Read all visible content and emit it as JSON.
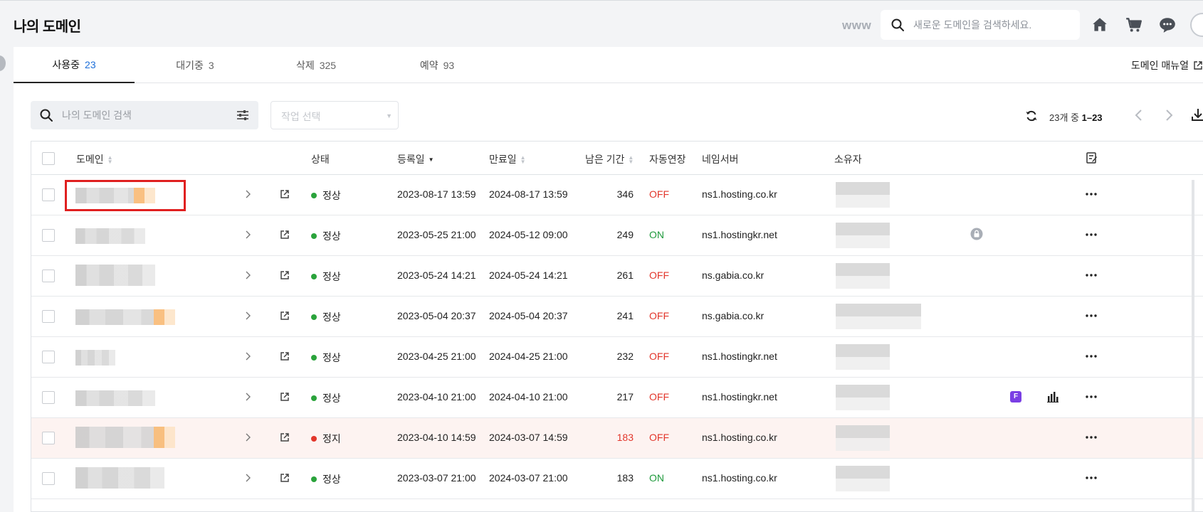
{
  "header": {
    "title": "나의 도메인",
    "www": "www",
    "search_placeholder": "새로운 도메인을 검색하세요."
  },
  "tabs": [
    {
      "label": "사용중",
      "count": "23",
      "active": true
    },
    {
      "label": "대기중",
      "count": "3"
    },
    {
      "label": "삭제",
      "count": "325"
    },
    {
      "label": "예약",
      "count": "93"
    }
  ],
  "manual_link": "도메인 매뉴얼",
  "toolbar": {
    "search_placeholder": "나의 도메인 검색",
    "action_select": "작업 선택",
    "range_prefix": "23개 중 ",
    "range_value": "1–23"
  },
  "table": {
    "columns": {
      "domain": "도메인",
      "status": "상태",
      "registered": "등록일",
      "expires": "만료일",
      "remaining": "남은 기간",
      "auto_renew": "자동연장",
      "nameserver": "네임서버",
      "owner": "소유자"
    },
    "rows": [
      {
        "status": "정상",
        "registered": "2023-08-17 13:59",
        "expires": "2024-08-17 13:59",
        "remaining": "346",
        "auto_renew": "OFF",
        "nameserver": "ns1.hosting.co.kr"
      },
      {
        "status": "정상",
        "registered": "2023-05-25 21:00",
        "expires": "2024-05-12 09:00",
        "remaining": "249",
        "auto_renew": "ON",
        "nameserver": "ns1.hostingkr.net"
      },
      {
        "status": "정상",
        "registered": "2023-05-24 14:21",
        "expires": "2024-05-24 14:21",
        "remaining": "261",
        "auto_renew": "OFF",
        "nameserver": "ns.gabia.co.kr"
      },
      {
        "status": "정상",
        "registered": "2023-05-04 20:37",
        "expires": "2024-05-04 20:37",
        "remaining": "241",
        "auto_renew": "OFF",
        "nameserver": "ns.gabia.co.kr"
      },
      {
        "status": "정상",
        "registered": "2023-04-25 21:00",
        "expires": "2024-04-25 21:00",
        "remaining": "232",
        "auto_renew": "OFF",
        "nameserver": "ns1.hostingkr.net"
      },
      {
        "status": "정상",
        "registered": "2023-04-10 21:00",
        "expires": "2024-04-10 21:00",
        "remaining": "217",
        "auto_renew": "OFF",
        "nameserver": "ns1.hostingkr.net"
      },
      {
        "status": "정지",
        "registered": "2023-04-10 14:59",
        "expires": "2024-03-07 14:59",
        "remaining": "183",
        "auto_renew": "OFF",
        "nameserver": "ns1.hosting.co.kr"
      },
      {
        "status": "정상",
        "registered": "2023-03-07 21:00",
        "expires": "2024-03-07 21:00",
        "remaining": "183",
        "auto_renew": "ON",
        "nameserver": "ns1.hosting.co.kr"
      }
    ],
    "badge_f": "F"
  },
  "colors": {
    "accent": "#1e6fd9",
    "ok": "#2aa33b",
    "stopped": "#e2362b",
    "highlight": "#e02020"
  }
}
